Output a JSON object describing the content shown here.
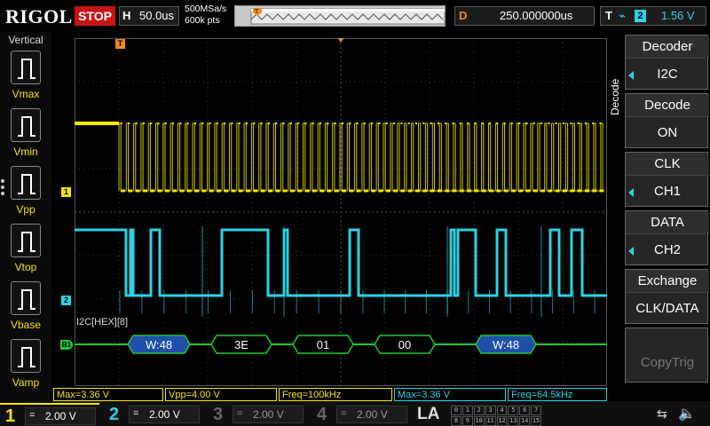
{
  "topbar": {
    "brand": "RIGOL",
    "run_state": "STOP",
    "horizontal_label": "H",
    "timebase": "50.0us",
    "sample_rate": "500MSa/s",
    "memory_depth": "600k pts",
    "delay_label": "D",
    "delay_value": "250.000000us",
    "trigger_label": "T",
    "trigger_edge": "⌁",
    "trigger_source": "2",
    "trigger_level": "1.56 V"
  },
  "left_menu": {
    "title": "Vertical",
    "items": [
      {
        "label": "Vmax"
      },
      {
        "label": "Vmin"
      },
      {
        "label": "Vpp"
      },
      {
        "label": "Vtop"
      },
      {
        "label": "Vbase"
      },
      {
        "label": "Vamp"
      }
    ]
  },
  "screen": {
    "trigger_pos_marker": "T",
    "ch1_marker": "1",
    "ch2_marker": "2",
    "bus_marker": "B1",
    "trig_level_marker": "T",
    "decode_label": "I2C[HEX][8]",
    "packets": [
      "W:48",
      "3E",
      "01",
      "00",
      "W:48"
    ],
    "colors": {
      "ch1": "#f5e600",
      "ch2": "#29d3e6",
      "bus": "#1ec832",
      "address_packet": "#1f4fa8",
      "data_packet": "#000000",
      "grid": "#3a3a3a"
    }
  },
  "right_menu": {
    "side_title": "Decode",
    "items": [
      {
        "title": "Decoder",
        "value": "I2C",
        "arrow": true
      },
      {
        "title": "Decode",
        "value": "ON",
        "arrow": false
      },
      {
        "title": "CLK",
        "value": "CH1",
        "arrow": true
      },
      {
        "title": "DATA",
        "value": "CH2",
        "arrow": true
      },
      {
        "title": "Exchange",
        "value": "CLK/DATA",
        "arrow": false
      },
      {
        "title": "",
        "value": "CopyTrig",
        "arrow": false
      }
    ]
  },
  "measurements": [
    {
      "text": "Max=3.36 V",
      "color": "#f5e600"
    },
    {
      "text": "Vpp=4.00 V",
      "color": "#f5e600"
    },
    {
      "text": "Freq=100kHz",
      "color": "#f5e600"
    },
    {
      "text": "Max=3.36 V",
      "color": "#29d3e6"
    },
    {
      "text": "Freq=64.5kHz",
      "color": "#29d3e6"
    }
  ],
  "channels": [
    {
      "num": "1",
      "coupling": "=",
      "scale": "2.00 V",
      "color": "#f5e600"
    },
    {
      "num": "2",
      "coupling": "=",
      "scale": "2.00 V",
      "color": "#29d3e6"
    },
    {
      "num": "3",
      "coupling": "=",
      "scale": "2.00 V",
      "color": "#c83cc8"
    },
    {
      "num": "4",
      "coupling": "=",
      "scale": "2.00 V",
      "color": "#3c64e6"
    }
  ],
  "la": {
    "label": "LA",
    "bits": [
      "0",
      "1",
      "2",
      "3",
      "4",
      "5",
      "6",
      "7",
      "8",
      "9",
      "10",
      "11",
      "12",
      "13",
      "14",
      "15"
    ]
  },
  "status_icons": {
    "usb": "usb-icon",
    "speaker": "speaker-icon"
  }
}
